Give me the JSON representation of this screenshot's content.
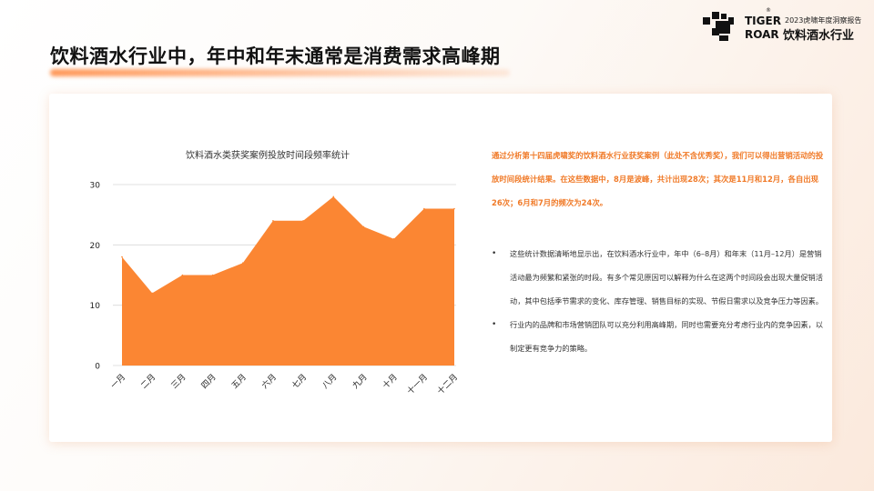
{
  "header": {
    "page_title": "饮料酒水行业中，年中和年末通常是消费需求高峰期",
    "brand_line1": "TIGER",
    "brand_line2": "ROAR",
    "report_subtitle": "2023虎啸年度洞察报告",
    "report_title": "饮料酒水行业"
  },
  "highlight_text": "通过分析第十四届虎啸奖的饮料酒水行业获奖案例（此处不含优秀奖），我们可以得出营销活动的投放时间段统计结果。在这些数据中，8月是波峰，共计出现28次；其次是11月和12月，各自出现26次；6月和7月的频次为24次。",
  "bullets": [
    "这些统计数据清晰地显示出，在饮料酒水行业中，年中（6–8月）和年末（11月–12月）是营销活动最为频繁和紧张的时段。有多个常见原因可以解释为什么在这两个时间段会出现大量促销活动，其中包括季节需求的变化、库存管理、销售目标的实现、节假日需求以及竞争压力等因素。",
    "行业内的品牌和市场营销团队可以充分利用高峰期，同时也需要充分考虑行业内的竞争因素，以制定更有竞争力的策略。"
  ],
  "colors": {
    "accent": "#fb8633",
    "highlight_text": "#f07a28"
  },
  "chart_data": {
    "type": "area",
    "title": "饮料酒水类获奖案例投放时间段频率统计",
    "categories": [
      "一月",
      "二月",
      "三月",
      "四月",
      "五月",
      "六月",
      "七月",
      "八月",
      "九月",
      "十月",
      "十一月",
      "十二月"
    ],
    "values": [
      18,
      12,
      15,
      15,
      17,
      24,
      24,
      28,
      23,
      21,
      26,
      26
    ],
    "ylim": [
      0,
      30
    ],
    "yticks": [
      "0",
      "10",
      "20",
      "30"
    ],
    "grid": true,
    "legend": "none"
  }
}
